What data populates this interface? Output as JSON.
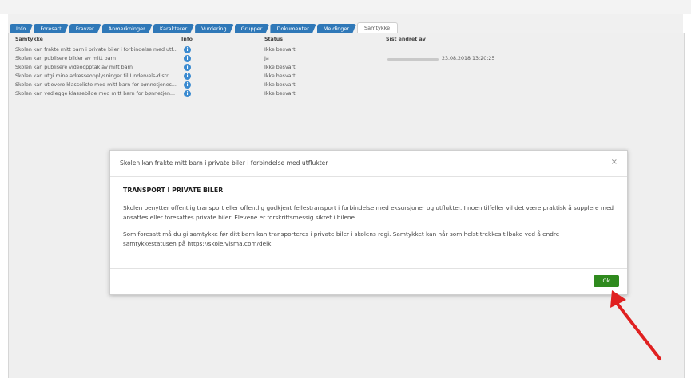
{
  "tabs": [
    {
      "label": "Info"
    },
    {
      "label": "Foresatt"
    },
    {
      "label": "Fravær"
    },
    {
      "label": "Anmerkninger"
    },
    {
      "label": "Karakterer"
    },
    {
      "label": "Vurdering"
    },
    {
      "label": "Grupper"
    },
    {
      "label": "Dokumenter"
    },
    {
      "label": "Meldinger"
    },
    {
      "label": "Samtykke",
      "active": true
    }
  ],
  "table": {
    "headers": {
      "consent": "Samtykke",
      "info": "Info",
      "status": "Status",
      "last_changed": "Sist endret av"
    },
    "rows": [
      {
        "consent": "Skolen kan frakte mitt barn i private biler i forbindelse med utf...",
        "info_icon": "info-icon",
        "status": "Ikke besvart",
        "last_changed": ""
      },
      {
        "consent": "Skolen kan publisere bilder av mitt barn",
        "info_icon": "info-icon",
        "status": "Ja",
        "last_changed": "23.08.2018 13:20:25"
      },
      {
        "consent": "Skolen kan publisere videoopptak av mitt barn",
        "info_icon": "info-icon",
        "status": "Ikke besvart",
        "last_changed": ""
      },
      {
        "consent": "Skolen kan utgi mine adresseopplysninger til Undervels-distri...",
        "info_icon": "info-icon",
        "status": "Ikke besvart",
        "last_changed": ""
      },
      {
        "consent": "Skolen kan utlevere klasseliste med mitt barn for bønnetjenes...",
        "info_icon": "info-icon",
        "status": "Ikke besvart",
        "last_changed": ""
      },
      {
        "consent": "Skolen kan vedlegge klassebilde med mitt barn for bønnetjen...",
        "info_icon": "info-icon",
        "status": "Ikke besvart",
        "last_changed": ""
      }
    ]
  },
  "modal": {
    "title": "Skolen kan frakte mitt barn i private biler i forbindelse med utflukter",
    "close": "×",
    "heading": "TRANSPORT I PRIVATE BILER",
    "paragraph1": "Skolen benytter offentlig transport eller offentlig godkjent fellestransport i forbindelse med eksursjoner og utflukter. I noen tilfeller vil det være praktisk å supplere med ansattes eller foresattes private biler. Elevene er forskriftsmessig sikret i bilene.",
    "paragraph2": "Som foresatt må du gi samtykke før ditt barn kan transporteres i private biler i skolens regi. Samtykket kan når som helst trekkes tilbake ved å endre samtykkestatusen på https://skole/visma.com/delk.",
    "ok_label": "Ok"
  },
  "colors": {
    "tab": "#2f78b8",
    "ok": "#2f8a1e",
    "arrow": "#e02020",
    "info": "#3a8ad0"
  }
}
